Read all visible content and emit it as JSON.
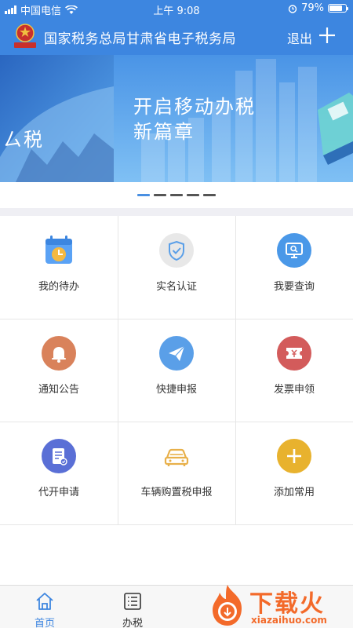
{
  "status_bar": {
    "carrier": "中国电信",
    "time": "上午 9:08",
    "battery_percent": "79%",
    "battery_level": 0.79
  },
  "header": {
    "title": "国家税务总局甘肃省电子税务局",
    "logout_label": "退出",
    "emblem_text": "中国税务"
  },
  "banner": {
    "headline_line1": "开启移动办税",
    "headline_line2": "新篇章",
    "left_partial_text": "ㄙ税",
    "slide_count": 5,
    "active_slide": 1
  },
  "services": [
    {
      "label": "我的待办",
      "icon": "calendar-clock-icon",
      "color": "#5aa2f5"
    },
    {
      "label": "实名认证",
      "icon": "shield-check-icon",
      "color": "#e8e8e8"
    },
    {
      "label": "我要查询",
      "icon": "monitor-search-icon",
      "color": "#4a98e8"
    },
    {
      "label": "通知公告",
      "icon": "bell-icon",
      "color": "#d9825b"
    },
    {
      "label": "快捷申报",
      "icon": "paper-plane-icon",
      "color": "#5a9fe8"
    },
    {
      "label": "发票申领",
      "icon": "ticket-icon",
      "color": "#d35b5b"
    },
    {
      "label": "代开申请",
      "icon": "document-edit-icon",
      "color": "#5a6fd6"
    },
    {
      "label": "车辆购置税申报",
      "icon": "car-icon",
      "color": "#e8b04a"
    },
    {
      "label": "添加常用",
      "icon": "plus-icon",
      "color": "#e8b22e"
    }
  ],
  "tabs": [
    {
      "label": "首页",
      "icon": "home-icon",
      "active": true
    },
    {
      "label": "办税",
      "icon": "list-icon",
      "active": false
    }
  ],
  "watermark": {
    "text": "下载火",
    "sub": "xiazaihuo.com"
  }
}
